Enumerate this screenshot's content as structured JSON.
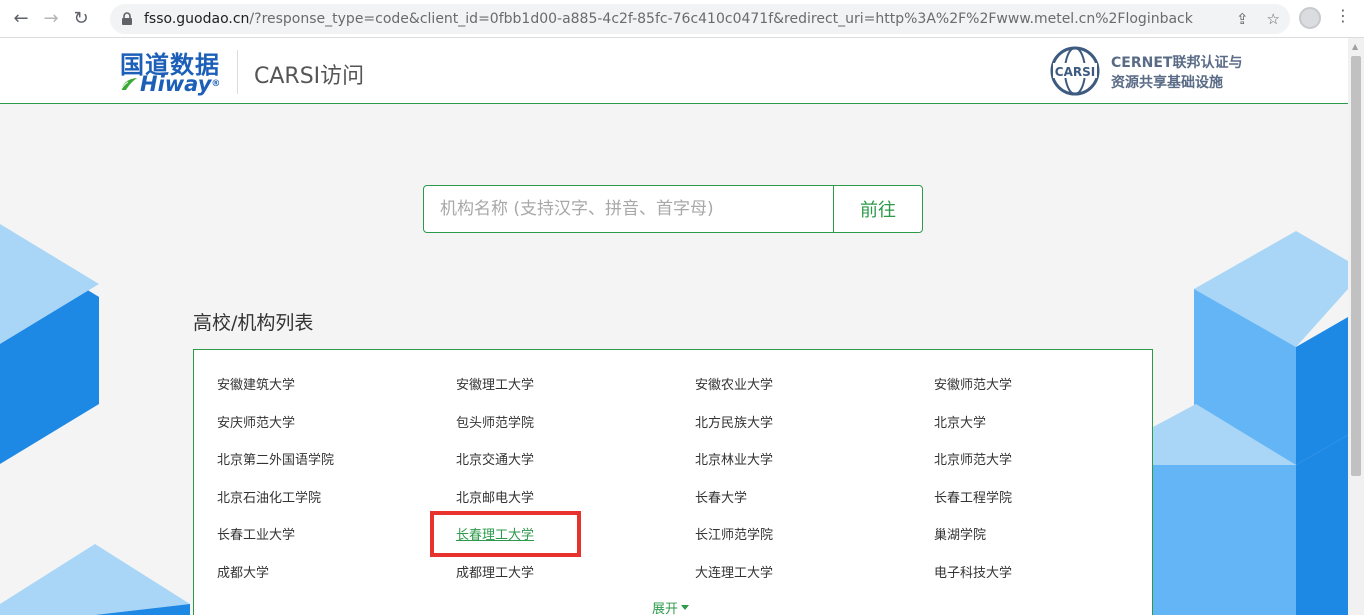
{
  "browser": {
    "url_host": "fsso.guodao.cn",
    "url_rest": "/?response_type=code&client_id=0fbb1d00-a885-4c2f-85fc-76c410c0471f&redirect_uri=http%3A%2F%2Fwww.metel.cn%2Floginback",
    "back_glyph": "←",
    "forward_glyph": "→",
    "reload_glyph": "↻",
    "share_glyph": "⇪",
    "star_glyph": "☆",
    "menu_glyph": "⋮"
  },
  "header": {
    "logo_cn": "国道数据",
    "logo_en": "Hiway",
    "logo_reg": "®",
    "carsi_access": "CARSI访问",
    "carsi_badge_text": "CARSI",
    "cernet_line1": "CERNET联邦认证与",
    "cernet_line2": "资源共享基础设施"
  },
  "search": {
    "placeholder": "机构名称 (支持汉字、拼音、首字母)",
    "value": "",
    "button_label": "前往"
  },
  "list": {
    "title": "高校/机构列表",
    "institutions": [
      "安徽建筑大学",
      "安徽理工大学",
      "安徽农业大学",
      "安徽师范大学",
      "安庆师范大学",
      "包头师范学院",
      "北方民族大学",
      "北京大学",
      "北京第二外国语学院",
      "北京交通大学",
      "北京林业大学",
      "北京师范大学",
      "北京石油化工学院",
      "北京邮电大学",
      "长春大学",
      "长春工程学院",
      "长春工业大学",
      "长春理工大学",
      "长江师范学院",
      "巢湖学院",
      "成都大学",
      "成都理工大学",
      "大连理工大学",
      "电子科技大学"
    ],
    "active_index": 17,
    "expand_label": "展开"
  },
  "colors": {
    "accent_green": "#2c9a4a",
    "brand_blue": "#1c5fb8",
    "highlight_red": "#e8322d",
    "cube_light": "#a9d6f7",
    "cube_mid": "#64b5f6",
    "cube_dark": "#1e88e5"
  }
}
